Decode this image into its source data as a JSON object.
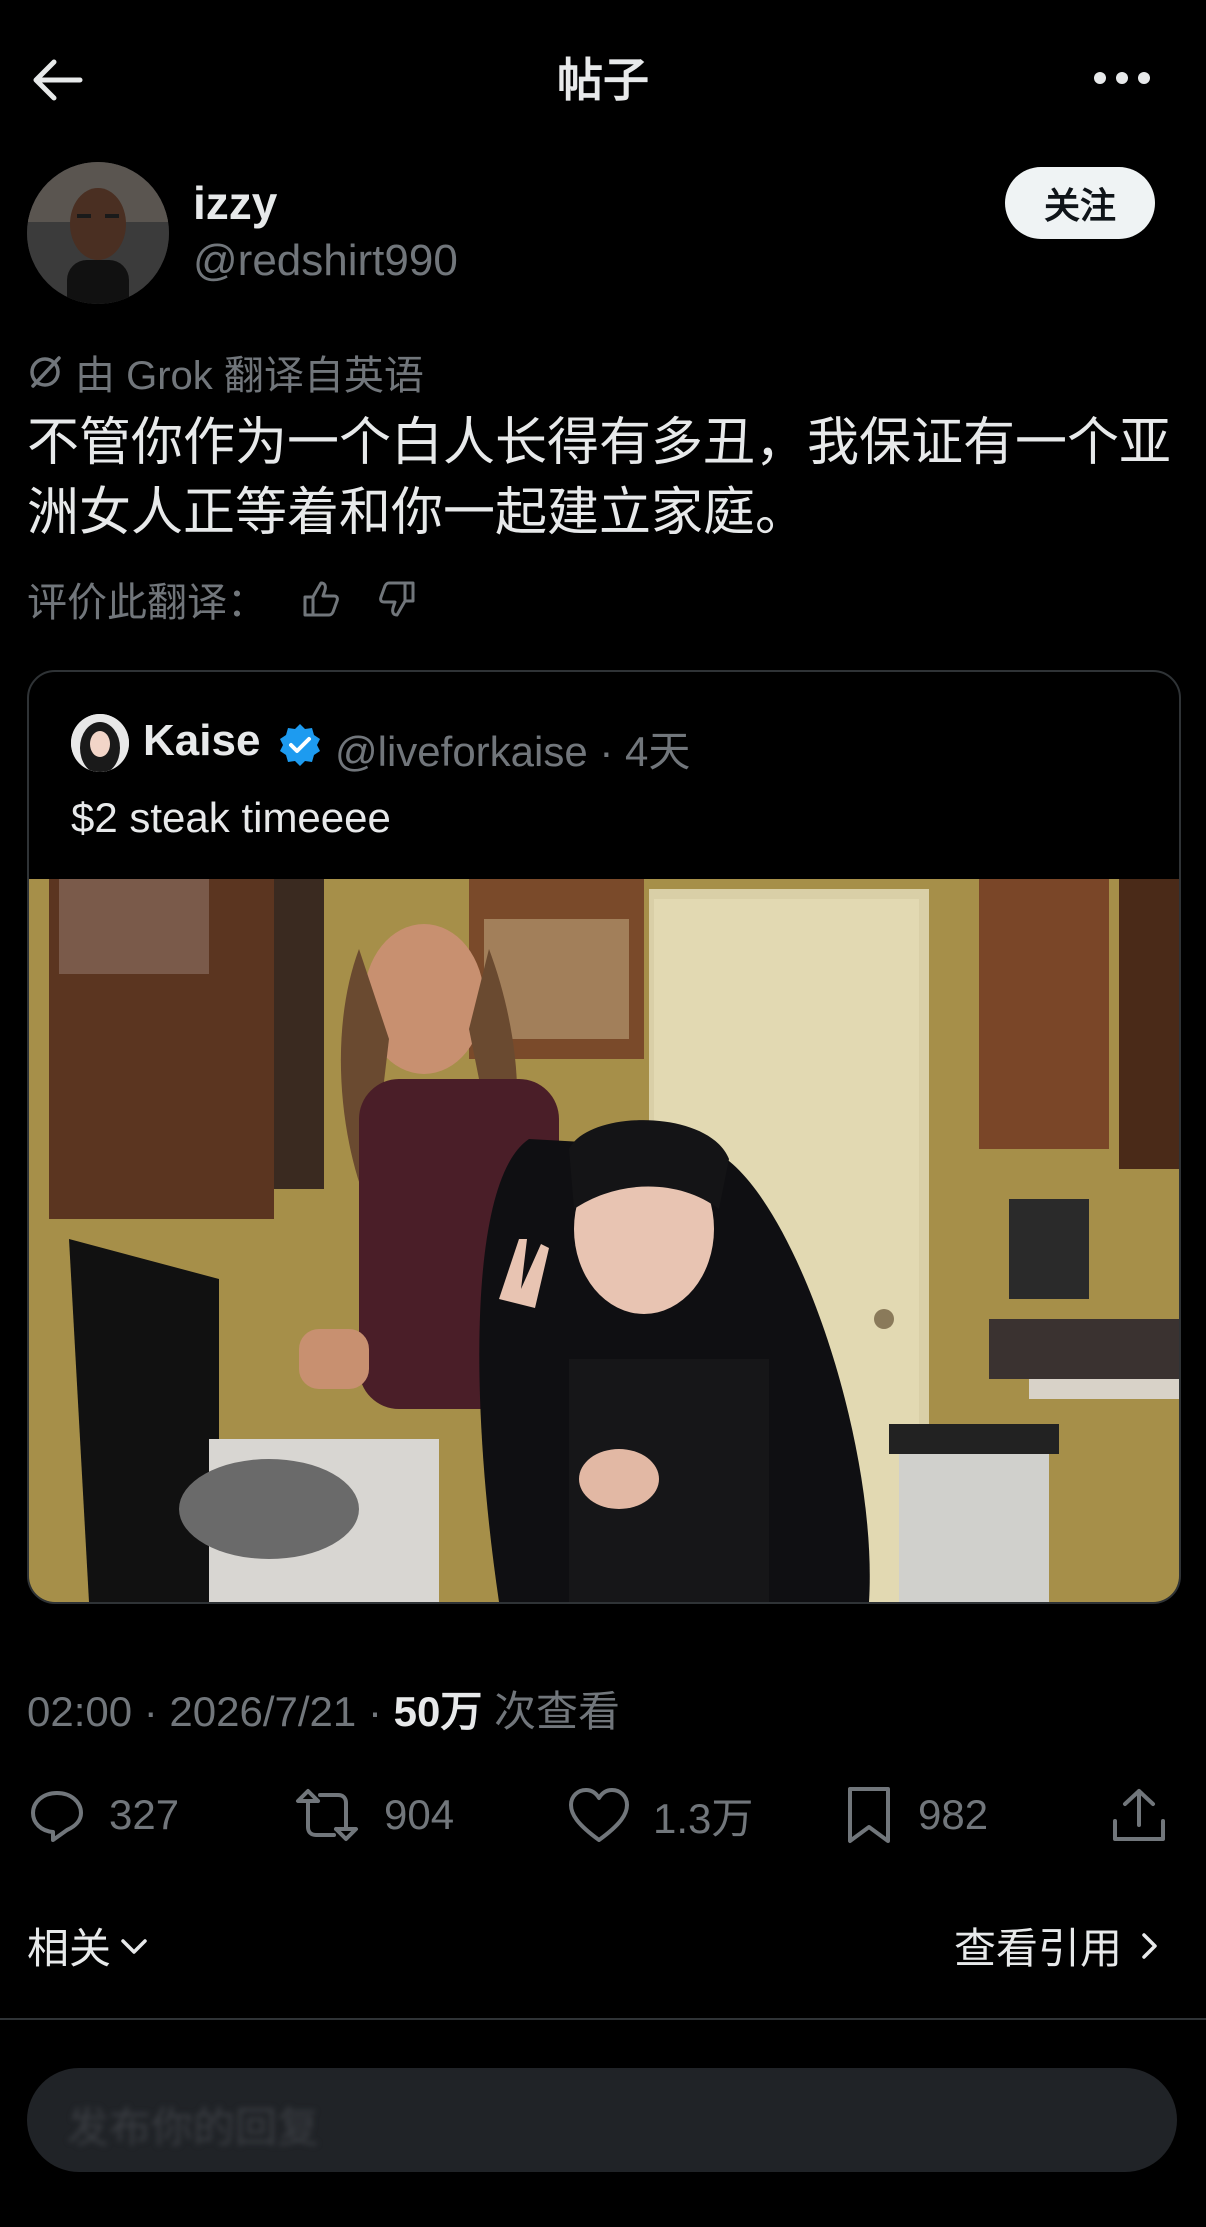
{
  "header": {
    "title": "帖子"
  },
  "author": {
    "name": "izzy",
    "handle": "@redshirt990",
    "follow_label": "关注"
  },
  "translation": {
    "notice": "由 Grok 翻译自英语",
    "text": "不管你作为一个白人长得有多丑，我保证有一个亚洲女人正等着和你一起建立家庭。",
    "rate_label": "评价此翻译："
  },
  "quote": {
    "name": "Kaise",
    "handle_time": "@liveforkaise · 4天",
    "text": "$2 steak timeeee"
  },
  "meta": {
    "time_date": "02:00 · 2026/7/21 · ",
    "views_count": "50万",
    "views_label": " 次查看"
  },
  "actions": {
    "replies": "327",
    "reposts": "904",
    "likes": "1.3万",
    "bookmarks": "982"
  },
  "footer": {
    "related": "相关",
    "view_quotes": "查看引用",
    "reply_placeholder": "发布你的回复"
  },
  "colors": {
    "background": "#000000",
    "text": "#e7e9ea",
    "muted": "#71767b",
    "verified": "#1d9bf0",
    "border": "#2f3336"
  }
}
